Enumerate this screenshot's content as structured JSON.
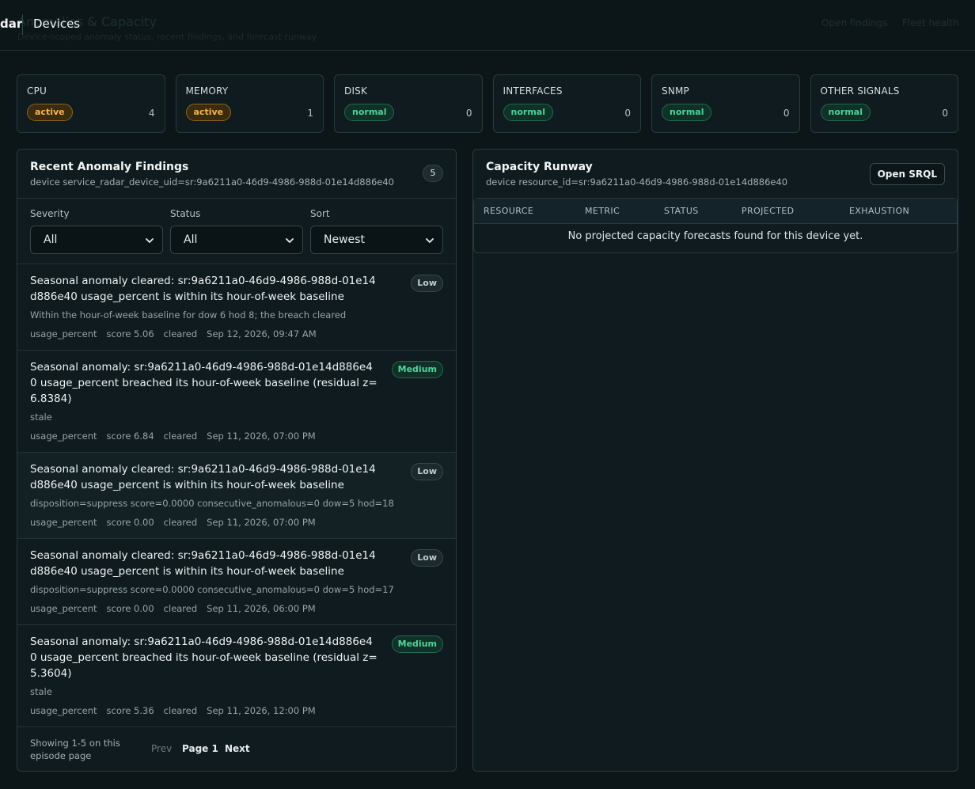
{
  "topbar": {
    "brand": "dar",
    "nav_devices": "Devices",
    "ghost_title": "Anomalies & Capacity",
    "ghost_subtitle": "Device-scoped anomaly status, recent findings, and forecast runway",
    "ghost_open_findings": "Open findings",
    "ghost_fleet_health": "Fleet health"
  },
  "cards": [
    {
      "label": "CPU",
      "status": "active",
      "count": "4"
    },
    {
      "label": "MEMORY",
      "status": "active",
      "count": "1"
    },
    {
      "label": "DISK",
      "status": "normal",
      "count": "0"
    },
    {
      "label": "INTERFACES",
      "status": "normal",
      "count": "0"
    },
    {
      "label": "SNMP",
      "status": "normal",
      "count": "0"
    },
    {
      "label": "OTHER SIGNALS",
      "status": "normal",
      "count": "0"
    }
  ],
  "findings_panel": {
    "title": "Recent Anomaly Findings",
    "subtitle": "device service_radar_device_uid=sr:9a6211a0-46d9-4986-988d-01e14d886e40",
    "count": "5",
    "filters": [
      {
        "label": "Severity",
        "value": "All"
      },
      {
        "label": "Status",
        "value": "All"
      },
      {
        "label": "Sort",
        "value": "Newest"
      }
    ],
    "items": [
      {
        "title": "Seasonal anomaly cleared: sr:9a6211a0-46d9-4986-988d-01e14d886e40 usage_percent is within its hour-of-week baseline",
        "severity": "Low",
        "desc": "Within the hour-of-week baseline for dow 6 hod 8; the breach cleared",
        "metric": "usage_percent",
        "score": "score 5.06",
        "state": "cleared",
        "time": "Sep 12, 2026, 09:47 AM"
      },
      {
        "title": "Seasonal anomaly: sr:9a6211a0-46d9-4986-988d-01e14d886e40 usage_percent breached its hour-of-week baseline (residual z=6.8384)",
        "severity": "Medium",
        "desc": "stale",
        "metric": "usage_percent",
        "score": "score 6.84",
        "state": "cleared",
        "time": "Sep 11, 2026, 07:00 PM"
      },
      {
        "title": "Seasonal anomaly cleared: sr:9a6211a0-46d9-4986-988d-01e14d886e40 usage_percent is within its hour-of-week baseline",
        "severity": "Low",
        "desc": "disposition=suppress score=0.0000 consecutive_anomalous=0 dow=5 hod=18",
        "metric": "usage_percent",
        "score": "score 0.00",
        "state": "cleared",
        "time": "Sep 11, 2026, 07:00 PM"
      },
      {
        "title": "Seasonal anomaly cleared: sr:9a6211a0-46d9-4986-988d-01e14d886e40 usage_percent is within its hour-of-week baseline",
        "severity": "Low",
        "desc": "disposition=suppress score=0.0000 consecutive_anomalous=0 dow=5 hod=17",
        "metric": "usage_percent",
        "score": "score 0.00",
        "state": "cleared",
        "time": "Sep 11, 2026, 06:00 PM"
      },
      {
        "title": "Seasonal anomaly: sr:9a6211a0-46d9-4986-988d-01e14d886e40 usage_percent breached its hour-of-week baseline (residual z=5.3604)",
        "severity": "Medium",
        "desc": "stale",
        "metric": "usage_percent",
        "score": "score 5.36",
        "state": "cleared",
        "time": "Sep 11, 2026, 12:00 PM"
      }
    ],
    "pager": {
      "info": "Showing 1-5 on this episode page",
      "prev": "Prev",
      "page": "Page 1",
      "next": "Next"
    }
  },
  "capacity_panel": {
    "title": "Capacity Runway",
    "subtitle": "device resource_id=sr:9a6211a0-46d9-4986-988d-01e14d886e40",
    "open_srql": "Open SRQL",
    "columns": [
      "RESOURCE",
      "METRIC",
      "STATUS",
      "PROJECTED",
      "EXHAUSTION"
    ],
    "empty_message": "No projected capacity forecasts found for this device yet."
  }
}
